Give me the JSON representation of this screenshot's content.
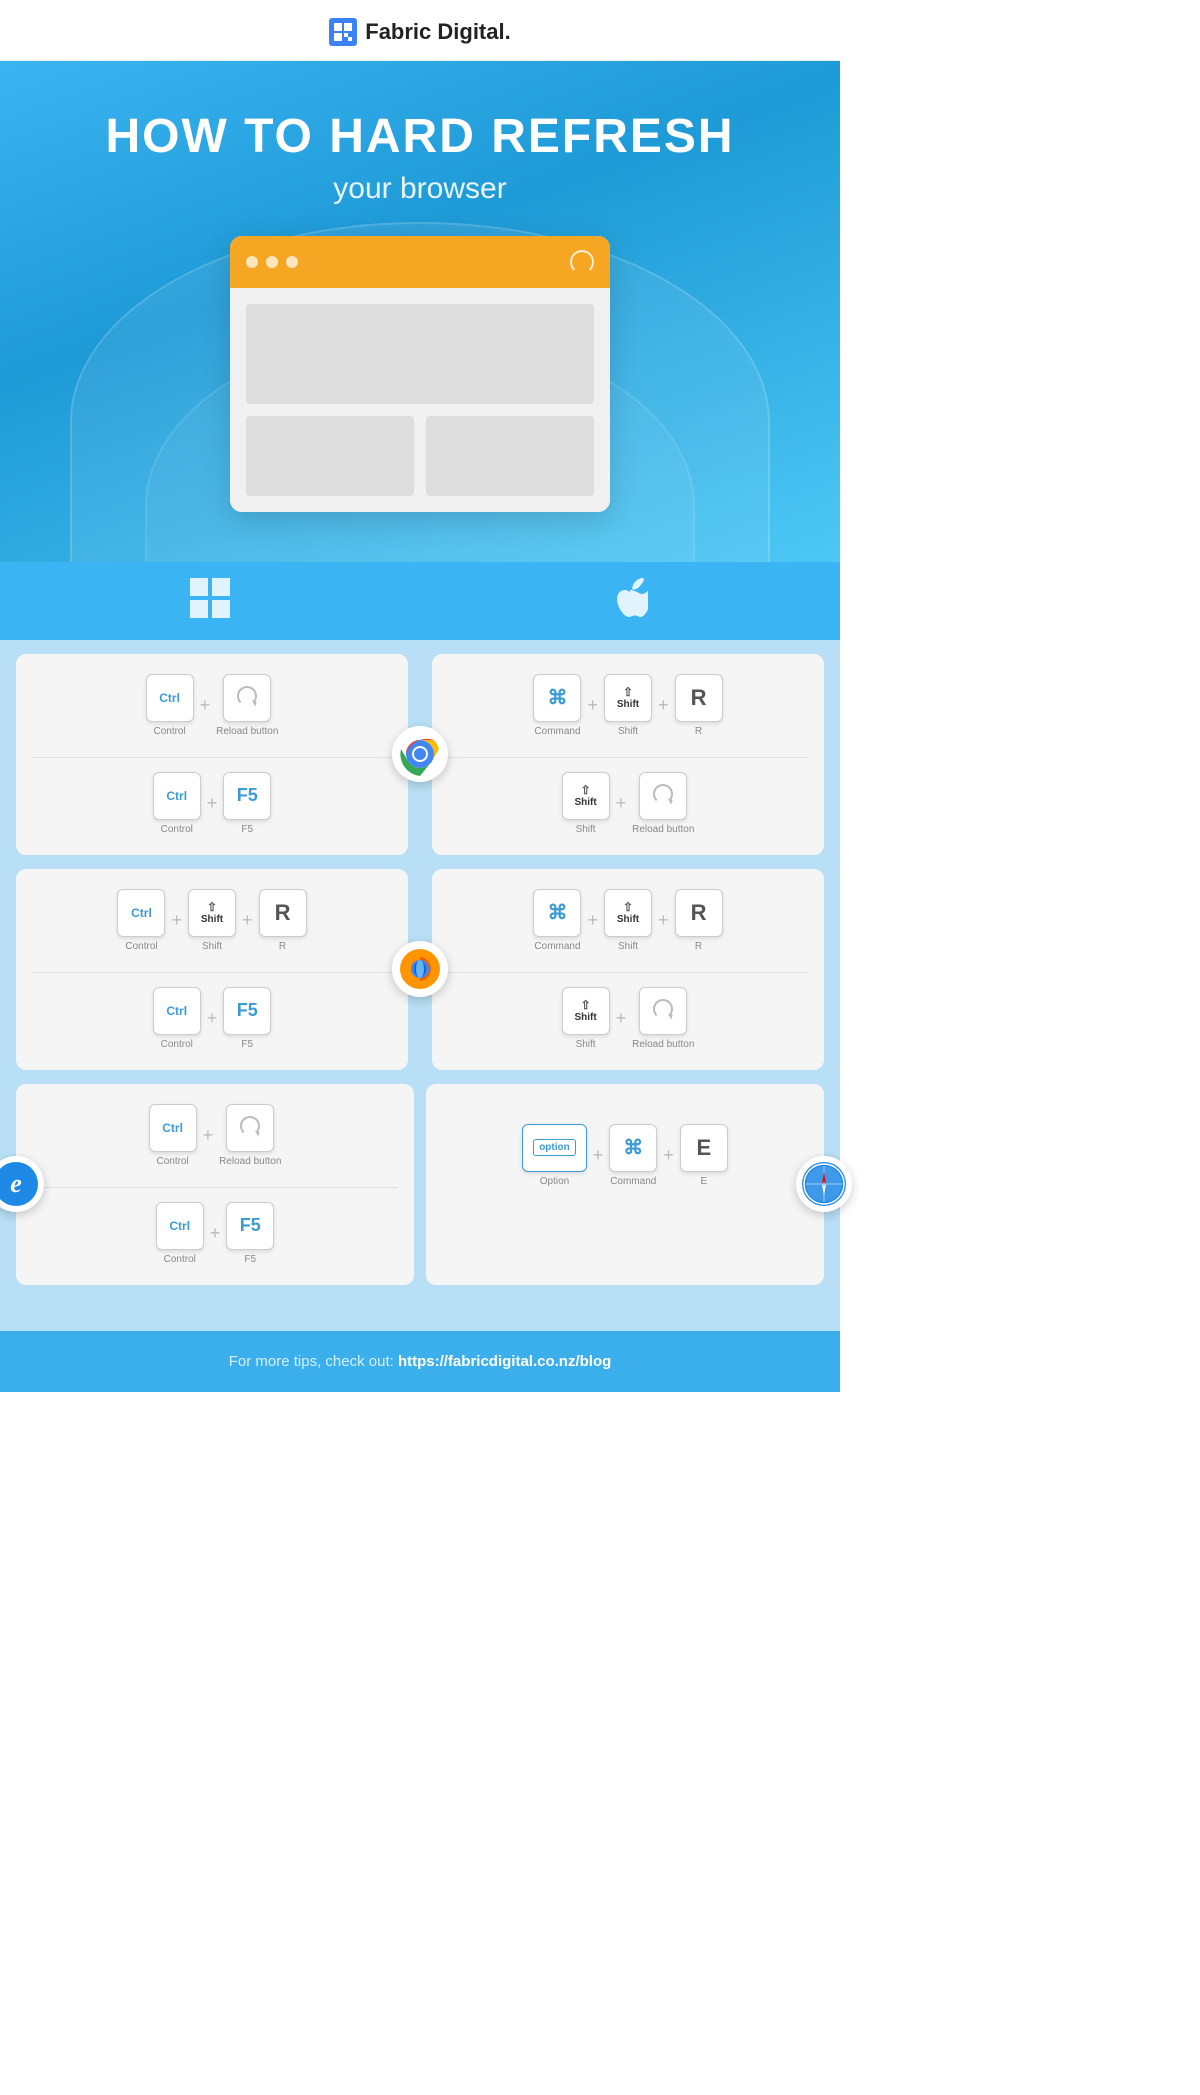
{
  "header": {
    "logo_text": "Fabric Digital.",
    "logo_icon": "F"
  },
  "hero": {
    "title": "HOW TO HARD REFRESH",
    "subtitle": "your browser"
  },
  "os": {
    "windows_label": "Windows",
    "mac_label": "Mac"
  },
  "chrome": {
    "name": "Chrome",
    "windows": {
      "combo1": [
        "Control",
        "Reload button"
      ],
      "combo2": [
        "Control",
        "F5"
      ]
    },
    "mac": {
      "combo1": [
        "Command",
        "Shift",
        "R"
      ],
      "combo2": [
        "Shift",
        "Reload button"
      ]
    }
  },
  "firefox": {
    "name": "Firefox",
    "windows": {
      "combo1": [
        "Control",
        "Shift",
        "R"
      ],
      "combo2": [
        "Control",
        "F5"
      ]
    },
    "mac": {
      "combo1": [
        "Command",
        "Shift",
        "R"
      ],
      "combo2": [
        "Shift",
        "Reload button"
      ]
    }
  },
  "ie": {
    "name": "Internet Explorer",
    "windows": {
      "combo1": [
        "Control",
        "Reload button"
      ],
      "combo2": [
        "Control",
        "F5"
      ]
    }
  },
  "safari": {
    "name": "Safari",
    "mac": {
      "combo1": [
        "Option",
        "Command",
        "E"
      ]
    }
  },
  "footer": {
    "text": "For more tips, check out:",
    "link": "https://fabricdigital.co.nz/blog"
  }
}
